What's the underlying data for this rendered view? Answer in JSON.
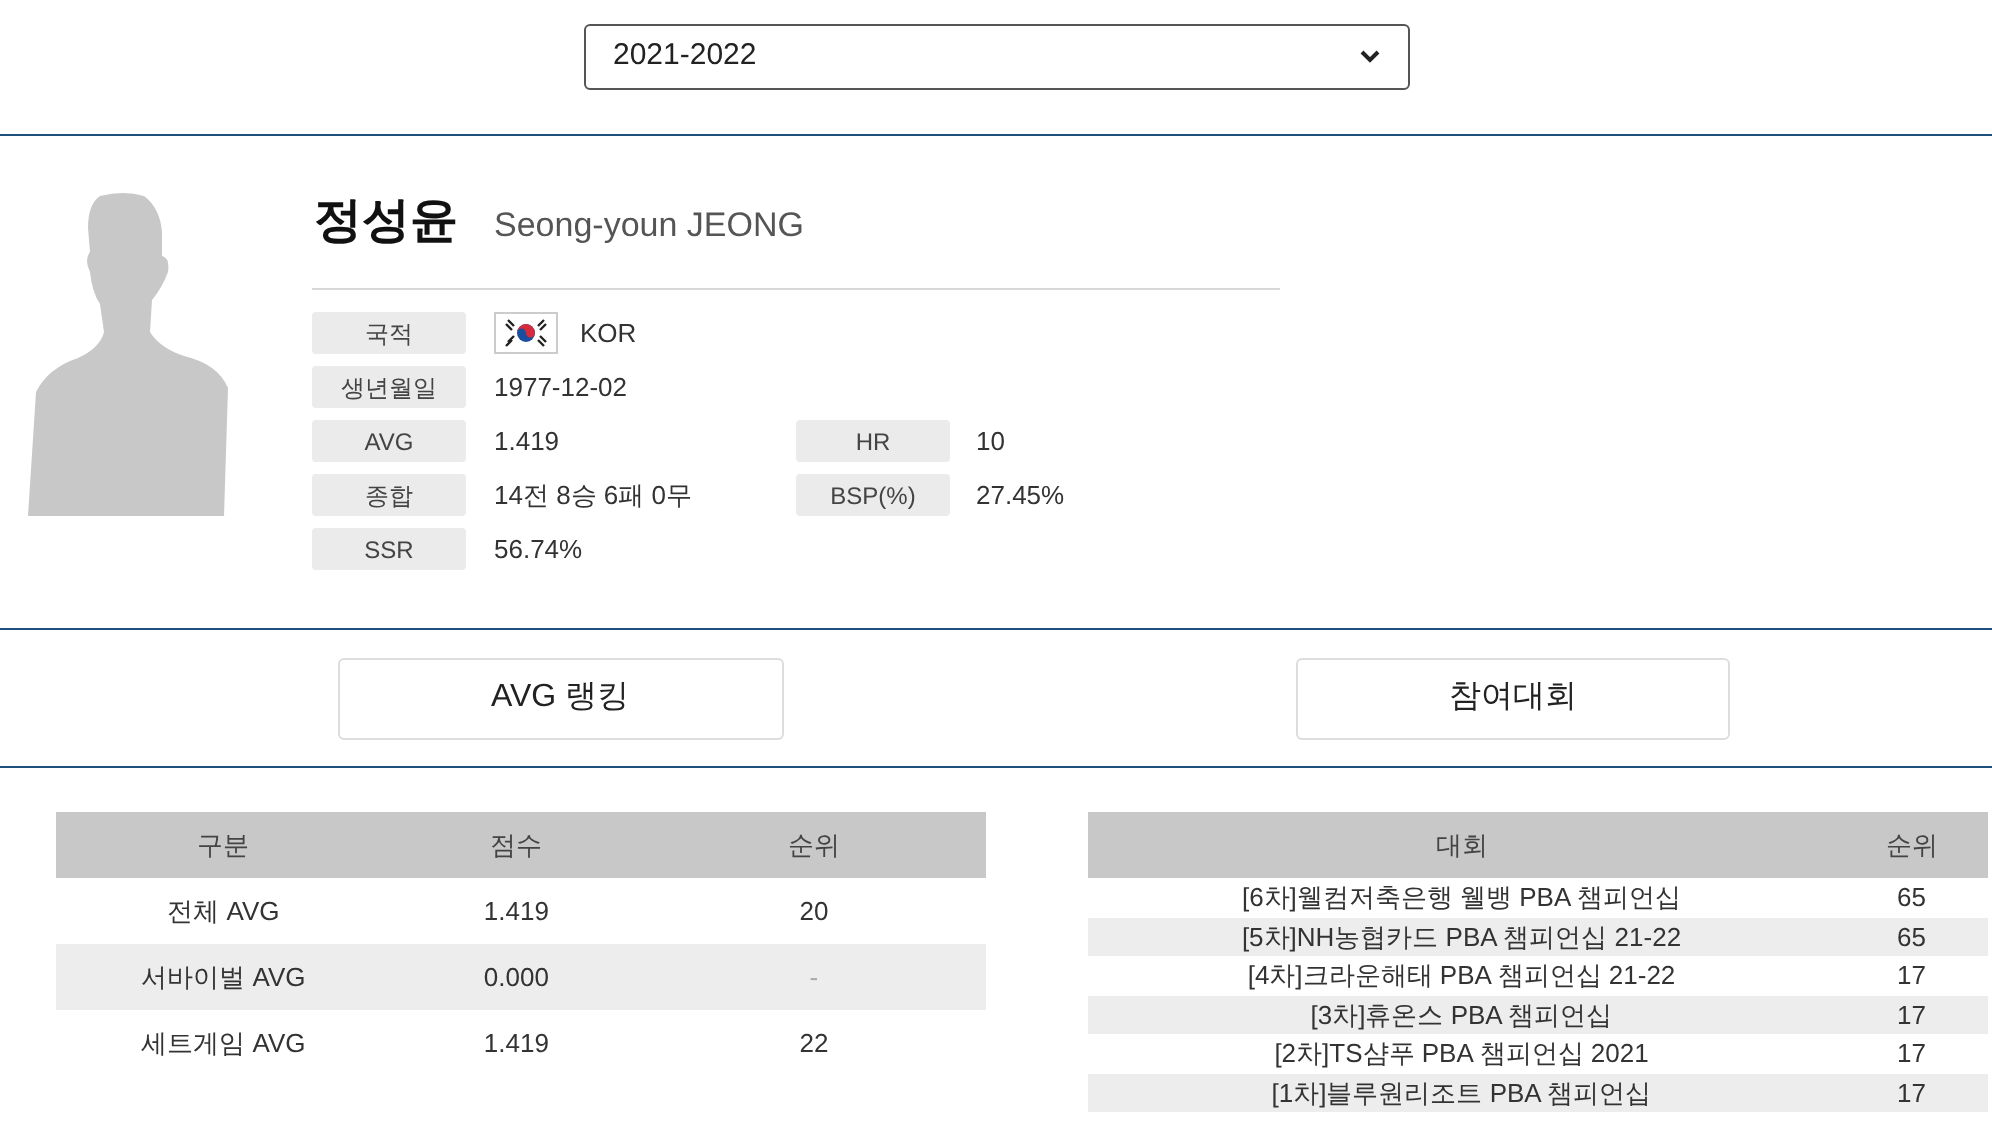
{
  "season_select": {
    "value": "2021-2022"
  },
  "player": {
    "name_ko": "정성윤",
    "name_en": "Seong-youn JEONG",
    "fields": [
      {
        "label": "국적",
        "value": "KOR",
        "flag": true
      },
      {
        "label": "생년월일",
        "value": "1977-12-02"
      },
      {
        "label": "AVG",
        "value": "1.419",
        "label2": "HR",
        "value2": "10"
      },
      {
        "label": "종합",
        "value": "14전 8승 6패 0무",
        "label2": "BSP(%)",
        "value2": "27.45%"
      },
      {
        "label": "SSR",
        "value": "56.74%"
      }
    ]
  },
  "buttons": [
    "AVG 랭킹",
    "참여대회"
  ],
  "ranking_table": {
    "columns": [
      "구분",
      "점수",
      "순위"
    ],
    "rows": [
      {
        "cells": [
          "전체 AVG",
          "1.419",
          "20"
        ]
      },
      {
        "cells": [
          "서바이벌 AVG",
          "0.000",
          "-"
        ]
      },
      {
        "cells": [
          "세트게임 AVG",
          "1.419",
          "22"
        ]
      }
    ]
  },
  "tournament_table": {
    "columns": [
      "대회",
      "순위"
    ],
    "rows": [
      {
        "cells": [
          "[6차]웰컴저축은행 웰뱅 PBA 챔피언십",
          "65"
        ]
      },
      {
        "cells": [
          "[5차]NH농협카드 PBA 챔피언십 21-22",
          "65"
        ]
      },
      {
        "cells": [
          "[4차]크라운해태 PBA 챔피언십 21-22",
          "17"
        ]
      },
      {
        "cells": [
          "[3차]휴온스 PBA 챔피언십",
          "17"
        ]
      },
      {
        "cells": [
          "[2차]TS샴푸 PBA 챔피언십 2021",
          "17"
        ]
      },
      {
        "cells": [
          "[1차]블루원리조트 PBA 챔피언십",
          "17"
        ]
      }
    ]
  }
}
